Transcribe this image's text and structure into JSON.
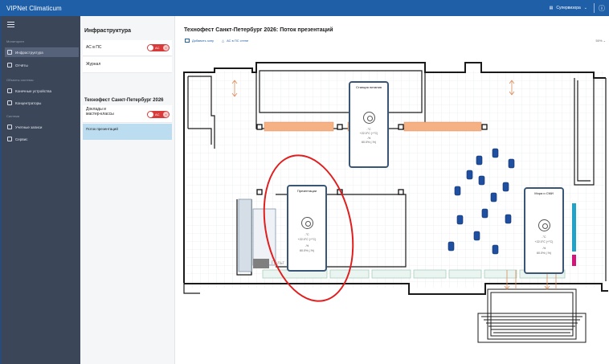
{
  "app": {
    "title": "VIPNet Climaticum",
    "user": "Супервизора",
    "info_icon": "info-icon"
  },
  "sidebar": {
    "sections": [
      {
        "label": "Мониторинг"
      },
      {
        "label": "Объекты системы"
      },
      {
        "label": "Система"
      }
    ],
    "items": [
      {
        "label": "Инфраструктура",
        "icon": "building-icon"
      },
      {
        "label": "Отчёты",
        "icon": "report-icon"
      },
      {
        "label": "Конечные устройства",
        "icon": "device-icon"
      },
      {
        "label": "Концентраторы",
        "icon": "hub-icon"
      },
      {
        "label": "Учетные записи",
        "icon": "user-icon"
      },
      {
        "label": "Сервис",
        "icon": "wrench-icon"
      }
    ]
  },
  "panel2": {
    "title": "Инфраструктура",
    "rows": [
      {
        "label": "АС в ПС",
        "toggle": "АС"
      },
      {
        "label": "Журнал"
      }
    ],
    "subtitle": "Технофест Санкт-Петербург 2026",
    "sub_rows": [
      {
        "label": "Доклады и мастер-классы",
        "toggle": "АС"
      },
      {
        "label": "Поток презентаций"
      }
    ]
  },
  "main": {
    "title": "Технофест Санкт-Петербург 2026: Поток презентаций",
    "tools": [
      "Добавить зону",
      "АС в ПС стене"
    ],
    "zoom": "50%",
    "floor_label": "Пульт"
  },
  "sensors": [
    {
      "name": "Станция питания",
      "temp_label": "-°С",
      "temp": "+22.0°С (+°С)",
      "hum_label": "-%",
      "hum": "60.0% (-%)"
    },
    {
      "name": "Презентации",
      "temp_label": "-°С",
      "temp": "+22.0°С (+°С)",
      "hum_label": "-%",
      "hum": "60.0% (-%)"
    },
    {
      "name": "Мора и СМИ",
      "temp_label": "-°С",
      "temp": "+22.0°С (+°С)",
      "hum_label": "-%",
      "hum": "60.0% (-%)"
    }
  ],
  "colors": {
    "topbar": "#1f5fa8",
    "sidebar": "#3b4658",
    "accent_red": "#e11d1d",
    "toggle": "#d93b3b",
    "selected": "#bcdcef",
    "barrel": "#1f4fa0",
    "strip": "#f5b183"
  }
}
